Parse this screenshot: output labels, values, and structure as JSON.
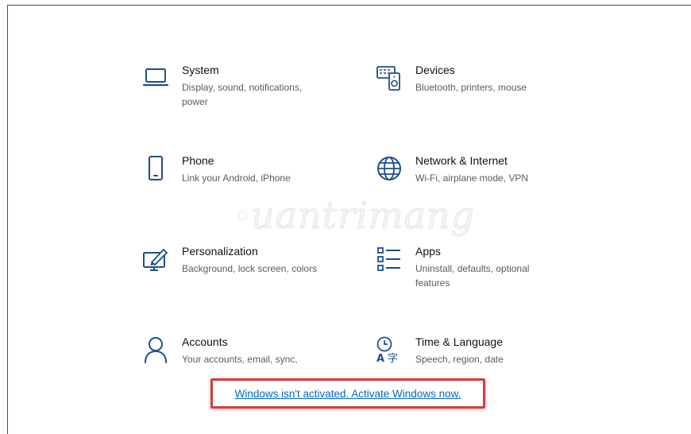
{
  "tiles": [
    {
      "icon": "laptop-icon",
      "title": "System",
      "desc": "Display, sound, notifications, power"
    },
    {
      "icon": "devices-icon",
      "title": "Devices",
      "desc": "Bluetooth, printers, mouse"
    },
    {
      "icon": "phone-icon",
      "title": "Phone",
      "desc": "Link your Android, iPhone"
    },
    {
      "icon": "globe-icon",
      "title": "Network & Internet",
      "desc": "Wi-Fi, airplane mode, VPN"
    },
    {
      "icon": "personalization-icon",
      "title": "Personalization",
      "desc": "Background, lock screen, colors"
    },
    {
      "icon": "apps-list-icon",
      "title": "Apps",
      "desc": "Uninstall, defaults, optional features"
    },
    {
      "icon": "person-icon",
      "title": "Accounts",
      "desc": "Your accounts, email, sync,"
    },
    {
      "icon": "time-language-icon",
      "title": "Time & Language",
      "desc": "Speech, region, date"
    }
  ],
  "watermark": {
    "text": "uantrimang"
  },
  "activation": {
    "link_text": "Windows isn't activated. Activate Windows now."
  },
  "colors": {
    "accent": "#0067c0",
    "highlight_border": "#d83c3c",
    "icon": "#1f4e8c"
  }
}
